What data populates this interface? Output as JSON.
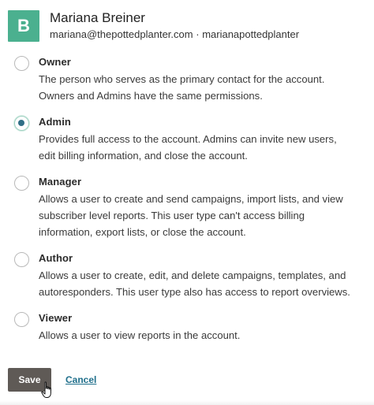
{
  "colors": {
    "accent": "#4bb08f",
    "save_button": "#5f5a56",
    "link": "#1f6f8b",
    "radio_selected": "#2f6f86"
  },
  "user": {
    "initial": "B",
    "name": "Mariana Breiner",
    "email": "mariana@thepottedplanter.com",
    "separator": "·",
    "username": "marianapottedplanter"
  },
  "roles": [
    {
      "title": "Owner",
      "description": "The person who serves as the primary contact for the account.\nOwners and Admins have the same permissions.",
      "selected": false
    },
    {
      "title": "Admin",
      "description": "Provides full access to the account. Admins can invite new users,\nedit billing information, and close the account.",
      "selected": true
    },
    {
      "title": "Manager",
      "description": "Allows a user to create and send campaigns, import lists, and view\nsubscriber level reports. This user type can't access billing\ninformation, export lists, or close the account.",
      "selected": false
    },
    {
      "title": "Author",
      "description": "Allows a user to create, edit, and delete campaigns, templates, and\nautoresponders. This user type also has access to report overviews.",
      "selected": false
    },
    {
      "title": "Viewer",
      "description": "Allows a user to view reports in the account.",
      "selected": false
    }
  ],
  "actions": {
    "save_label": "Save",
    "cancel_label": "Cancel"
  },
  "cursor": "hand-pointer-icon"
}
